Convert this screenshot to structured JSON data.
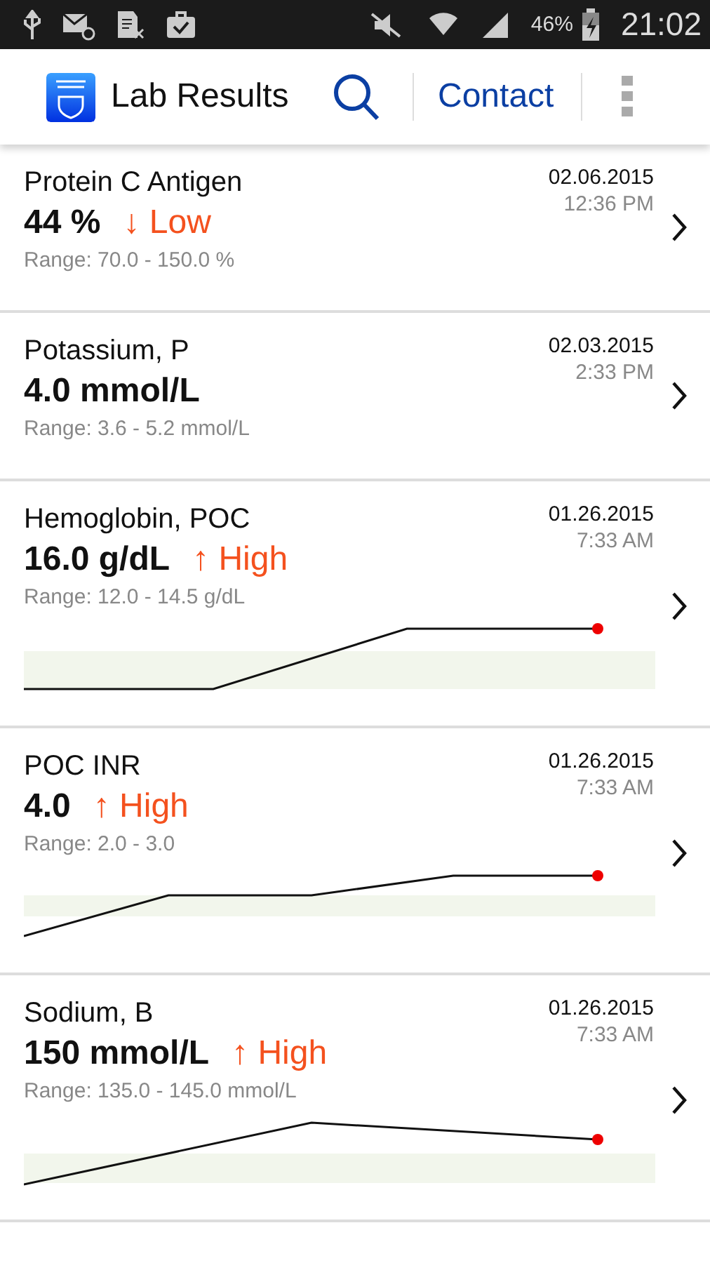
{
  "status_bar": {
    "battery_percent": "46%",
    "time": "21:02"
  },
  "app_bar": {
    "title": "Lab Results",
    "contact": "Contact"
  },
  "results": [
    {
      "name": "Protein C Antigen",
      "value": "44 %",
      "flag": {
        "arrow": "↓",
        "label": "Low"
      },
      "range": "Range: 70.0 - 150.0 %",
      "date": "02.06.2015",
      "time": "12:36 PM"
    },
    {
      "name": "Potassium, P",
      "value": "4.0 mmol/L",
      "range": "Range: 3.6 - 5.2 mmol/L",
      "date": "02.03.2015",
      "time": "2:33 PM"
    },
    {
      "name": "Hemoglobin, POC",
      "value": "16.0 g/dL",
      "flag": {
        "arrow": "↑",
        "label": "High"
      },
      "range": "Range: 12.0 - 14.5 g/dL",
      "date": "01.26.2015",
      "time": "7:33 AM",
      "trend": true
    },
    {
      "name": "POC INR",
      "value": "4.0",
      "flag": {
        "arrow": "↑",
        "label": "High"
      },
      "range": "Range: 2.0 - 3.0",
      "date": "01.26.2015",
      "time": "7:33 AM",
      "trend": true
    },
    {
      "name": "Sodium, B",
      "value": "150 mmol/L",
      "flag": {
        "arrow": "↑",
        "label": "High"
      },
      "range": "Range: 135.0 - 145.0 mmol/L",
      "date": "01.26.2015",
      "time": "7:33 AM",
      "trend": true
    }
  ]
}
